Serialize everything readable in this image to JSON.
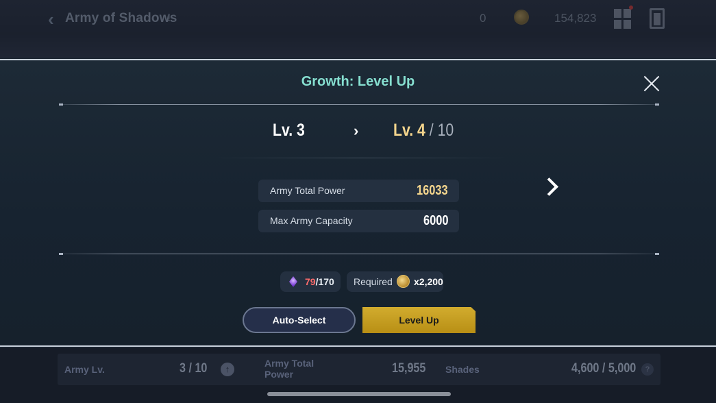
{
  "header": {
    "title": "Army of Shadows",
    "info_icon": "info-icon",
    "count": "0",
    "gold_amount": "154,823"
  },
  "modal": {
    "title": "Growth: Level Up",
    "level": {
      "current": "Lv. 3",
      "arrow": "›",
      "next": "Lv. 4",
      "max": " / 10"
    },
    "stats": [
      {
        "label": "Army Total Power",
        "value": "16033",
        "color": "#f4d58d"
      },
      {
        "label": "Max Army Capacity",
        "value": "6000",
        "color": "#ffffff"
      }
    ],
    "requirements": {
      "shards_have": "79",
      "shards_need": "/170",
      "required_label": "Required",
      "gold_amount": "x2,200"
    },
    "buttons": {
      "auto_select": "Auto-Select",
      "level_up": "Level Up"
    }
  },
  "bottom": {
    "army_lv_label": "Army Lv.",
    "army_lv_value": "3 / 10",
    "total_power_label": "Army Total Power",
    "total_power_value": "15,955",
    "shades_label": "Shades",
    "shades_value": "4,600 / 5,000",
    "help_icon_glyph": "?",
    "up_icon_glyph": "↑"
  },
  "colors": {
    "title_accent": "#86dfd0",
    "gold_text": "#f4d58d",
    "button_gold": "#d2ac2e",
    "shard_short": "#ff6b6b"
  }
}
